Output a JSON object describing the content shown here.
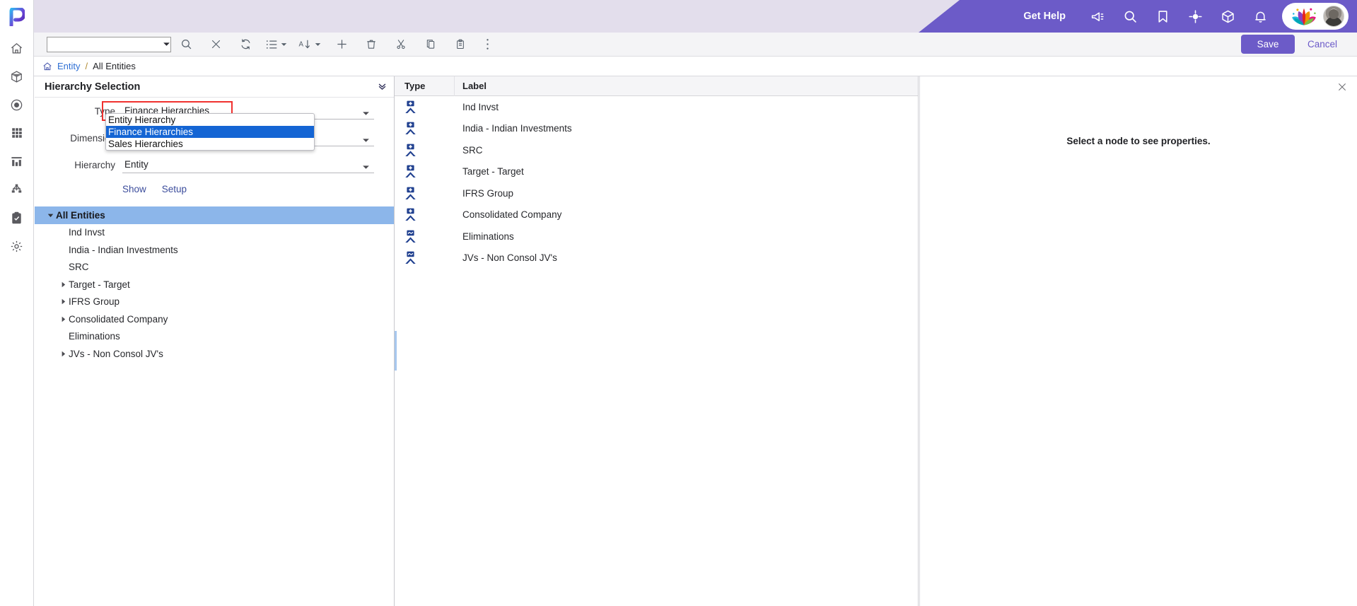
{
  "rail": {
    "logo": "p-logo",
    "items": [
      {
        "name": "home-icon",
        "label": "Home"
      },
      {
        "name": "cube-icon",
        "label": "Models"
      },
      {
        "name": "target-circle-icon",
        "label": "Targets"
      },
      {
        "name": "grid-apps-icon",
        "label": "Apps"
      },
      {
        "name": "bar-chart-icon",
        "label": "Reports"
      },
      {
        "name": "hierarchy-icon",
        "label": "Hierarchies"
      },
      {
        "name": "clipboard-check-icon",
        "label": "Tasks"
      },
      {
        "name": "gear-icon",
        "label": "Settings"
      }
    ]
  },
  "topbar": {
    "get_help": "Get Help",
    "icons": [
      {
        "name": "megaphone-icon"
      },
      {
        "name": "search-icon"
      },
      {
        "name": "bookmark-icon"
      },
      {
        "name": "crosshair-icon"
      },
      {
        "name": "box-icon"
      },
      {
        "name": "bell-icon"
      }
    ],
    "brand_logo": "lotus-logo",
    "avatar": "user-avatar"
  },
  "toolbar": {
    "search_value": "",
    "search_placeholder": "",
    "buttons": [
      {
        "name": "search-icon",
        "label": "Search"
      },
      {
        "name": "close-icon",
        "label": "Clear"
      },
      {
        "name": "refresh-icon",
        "label": "Refresh"
      },
      {
        "name": "list-view-icon",
        "label": "View"
      },
      {
        "name": "sort-az-icon",
        "label": "Sort"
      },
      {
        "name": "plus-icon",
        "label": "Add"
      },
      {
        "name": "trash-icon",
        "label": "Delete"
      },
      {
        "name": "scissors-icon",
        "label": "Cut"
      },
      {
        "name": "copy-icon",
        "label": "Copy"
      },
      {
        "name": "paste-icon",
        "label": "Paste"
      },
      {
        "name": "more-vertical-icon",
        "label": "More"
      }
    ],
    "save_label": "Save",
    "cancel_label": "Cancel",
    "accent_color": "#6c5bc8"
  },
  "breadcrumb": {
    "home_icon": "home-icon",
    "root": "Entity",
    "separator": "/",
    "current": "All Entities"
  },
  "hierarchy_panel": {
    "title": "Hierarchy Selection",
    "fields": [
      {
        "label": "Type",
        "value": "Finance Hierarchies",
        "highlighted": true
      },
      {
        "label": "Dimension",
        "value": "",
        "highlighted": false
      },
      {
        "label": "Hierarchy",
        "value": "Entity",
        "highlighted": false
      }
    ],
    "links": [
      {
        "label": "Show"
      },
      {
        "label": "Setup"
      }
    ],
    "dropdown": {
      "open": true,
      "selected": "Finance Hierarchies",
      "options": [
        "Entity Hierarchy",
        "Finance Hierarchies",
        "Sales Hierarchies"
      ]
    },
    "tree": [
      {
        "label": "All Entities",
        "depth": 0,
        "expander": "down",
        "selected": true
      },
      {
        "label": "Ind Invst",
        "depth": 1,
        "expander": "none",
        "selected": false
      },
      {
        "label": "India - Indian Investments",
        "depth": 1,
        "expander": "none",
        "selected": false
      },
      {
        "label": "SRC",
        "depth": 1,
        "expander": "none",
        "selected": false
      },
      {
        "label": "Target - Target",
        "depth": 1,
        "expander": "right",
        "selected": false
      },
      {
        "label": "IFRS Group",
        "depth": 1,
        "expander": "right",
        "selected": false
      },
      {
        "label": "Consolidated Company",
        "depth": 1,
        "expander": "right",
        "selected": false
      },
      {
        "label": "Eliminations",
        "depth": 1,
        "expander": "none",
        "selected": false
      },
      {
        "label": "JVs - Non Consol JV's",
        "depth": 1,
        "expander": "right",
        "selected": false
      }
    ]
  },
  "grid": {
    "columns": [
      "Type",
      "Label"
    ],
    "rows": [
      {
        "type_icon": "node-plus-icon",
        "label": "Ind Invst"
      },
      {
        "type_icon": "node-plus-icon",
        "label": "India - Indian Investments"
      },
      {
        "type_icon": "node-plus-icon",
        "label": "SRC"
      },
      {
        "type_icon": "node-plus-icon",
        "label": "Target - Target"
      },
      {
        "type_icon": "node-plus-icon",
        "label": "IFRS Group"
      },
      {
        "type_icon": "node-plus-icon",
        "label": "Consolidated Company"
      },
      {
        "type_icon": "node-tilde-icon",
        "label": "Eliminations"
      },
      {
        "type_icon": "node-tilde-icon",
        "label": "JVs - Non Consol JV's"
      }
    ]
  },
  "properties_panel": {
    "empty_message": "Select a node to see properties.",
    "close_icon": "close-icon"
  }
}
